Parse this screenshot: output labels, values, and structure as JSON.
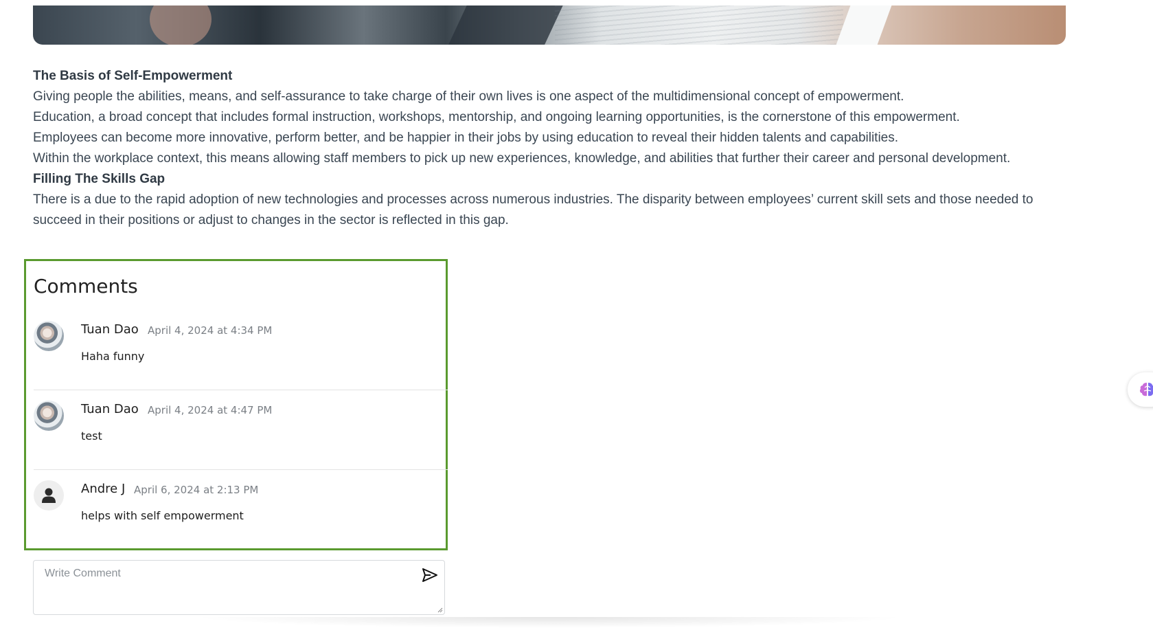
{
  "article": {
    "section1_title": "The Basis of Self-Empowerment",
    "section1_paragraphs": [
      "Giving people the abilities, means, and self-assurance to take charge of their own lives is one aspect of the multidimensional concept of empowerment.",
      "Education, a broad concept that includes formal instruction, workshops, mentorship, and ongoing learning opportunities, is the cornerstone of this empowerment.",
      "Employees can become more innovative, perform better, and be happier in their jobs by using education to reveal their hidden talents and capabilities.",
      "Within the workplace context, this means allowing staff members to pick up new experiences, knowledge, and abilities that further their career and personal development."
    ],
    "section2_title": "Filling The Skills Gap",
    "section2_paragraph": "There is a  due to the rapid adoption of new technologies and processes across numerous industries. The disparity between employees’ current skill sets and those needed to succeed in their positions or adjust to changes in the sector is reflected in this gap."
  },
  "comments": {
    "title": "Comments",
    "items": [
      {
        "author": "Tuan Dao",
        "timestamp": "April 4, 2024 at 4:34 PM",
        "text": "Haha funny",
        "avatar": "photo"
      },
      {
        "author": "Tuan Dao",
        "timestamp": "April 4, 2024 at 4:47 PM",
        "text": "test",
        "avatar": "photo"
      },
      {
        "author": "Andre J",
        "timestamp": "April 6, 2024 at 2:13 PM",
        "text": "helps with self empowerment",
        "avatar": "default-user-icon"
      }
    ]
  },
  "write_comment": {
    "placeholder": "Write Comment",
    "send_icon": "send-icon"
  },
  "floating_button": {
    "icon": "brain-icon"
  },
  "colors": {
    "highlight_border": "#5a9a2f",
    "body_text": "#3a4652",
    "timestamp_text": "#7a7f85"
  }
}
